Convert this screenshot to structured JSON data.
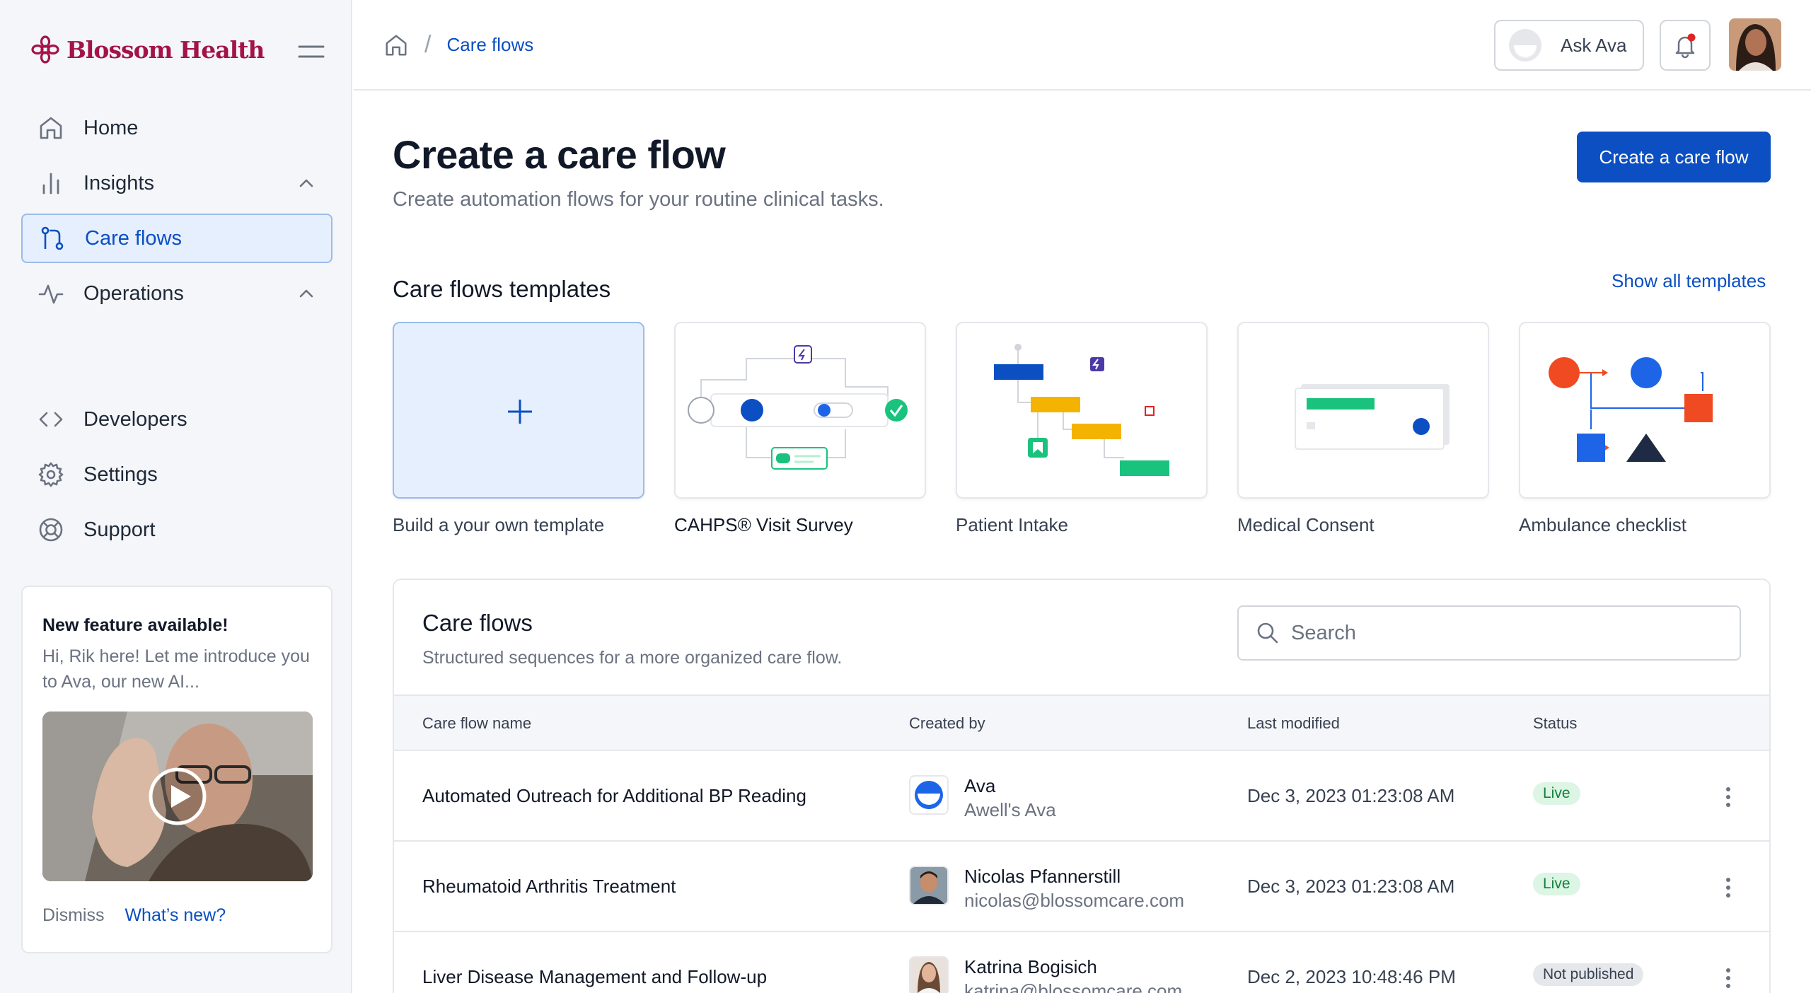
{
  "brand": {
    "name": "Blossom Health",
    "color": "#a3134a"
  },
  "sidebar": {
    "items": [
      {
        "label": "Home",
        "icon": "home-icon"
      },
      {
        "label": "Insights",
        "icon": "bar-chart-icon"
      },
      {
        "label": "Care flows",
        "icon": "flow-icon",
        "active": true
      },
      {
        "label": "Operations",
        "icon": "activity-icon"
      }
    ],
    "secondary": [
      {
        "label": "Developers",
        "icon": "code-icon"
      },
      {
        "label": "Settings",
        "icon": "gear-icon"
      },
      {
        "label": "Support",
        "icon": "lifebuoy-icon"
      }
    ],
    "feature": {
      "title": "New feature available!",
      "text": "Hi, Rik here! Let me introduce you to Ava, our new AI...",
      "dismiss": "Dismiss",
      "whats_new": "What’s new?"
    }
  },
  "header": {
    "breadcrumb": "Care flows",
    "ask_ava": "Ask Ava"
  },
  "main": {
    "title": "Create a care flow",
    "subtitle": "Create automation flows for your routine clinical tasks.",
    "create_button": "Create a care flow",
    "templates_title": "Care flows templates",
    "show_all": "Show all templates",
    "templates": [
      "Build a your own template",
      "CAHPS® Visit Survey",
      "Patient Intake",
      "Medical Consent",
      "Ambulance checklist"
    ]
  },
  "table": {
    "title": "Care flows",
    "subtitle": "Structured sequences for a more organized care flow.",
    "search_placeholder": "Search",
    "columns": [
      "Care flow name",
      "Created by",
      "Last modified",
      "Status"
    ],
    "rows": [
      {
        "name": "Automated Outreach for Additional BP Reading",
        "creator": "Ava",
        "creator_sub": "Awell's Ava",
        "modified": "Dec 3, 2023 01:23:08 AM",
        "status": "Live"
      },
      {
        "name": "Rheumatoid Arthritis Treatment",
        "creator": "Nicolas Pfannerstill",
        "creator_sub": "nicolas@blossomcare.com",
        "modified": "Dec 3, 2023 01:23:08 AM",
        "status": "Live"
      },
      {
        "name": "Liver Disease Management and Follow-up",
        "creator": "Katrina Bogisich",
        "creator_sub": "katrina@blossomcare.com",
        "modified": "Dec 2, 2023 10:48:46 PM",
        "status": "Not published"
      }
    ]
  },
  "colors": {
    "primary": "#0b4fc2",
    "live_bg": "#dcf5e4",
    "live_text": "#15803d"
  }
}
